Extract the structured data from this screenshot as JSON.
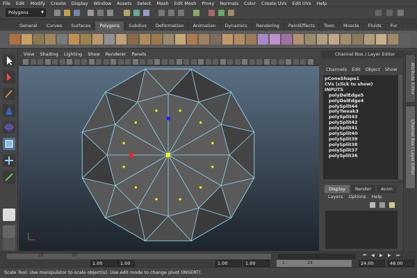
{
  "menubar": [
    "File",
    "Edit",
    "Modify",
    "Create",
    "Display",
    "Window",
    "Assets",
    "Select",
    "Mesh",
    "Edit Mesh",
    "Proxy",
    "Normals",
    "Color",
    "Create UVs",
    "Edit UVs",
    "Help"
  ],
  "status_line": {
    "mode": "Polygons"
  },
  "shelf_tabs": [
    "General",
    "Curves",
    "Surfaces",
    "Polygons",
    "Subdivs",
    "Deformation",
    "Animation",
    "Dynamics",
    "Rendering",
    "PaintEffects",
    "Toon",
    "Muscle",
    "Fluids",
    "Fur"
  ],
  "shelf_active": "Polygons",
  "panel_menu": [
    "View",
    "Shading",
    "Lighting",
    "Show",
    "Renderer",
    "Panels"
  ],
  "channel_box": {
    "title": "Channel Box / Layer Editor",
    "menu": [
      "Channels",
      "Edit",
      "Object",
      "Show"
    ],
    "items": [
      "pConeShape1",
      "CVs (click to show)",
      "INPUTS",
      "polyDelEdge5",
      "polyDelEdge4",
      "polySplit44",
      "polyTweak3",
      "polySplit43",
      "polySplit42",
      "polySplit41",
      "polySplit40",
      "polySplit39",
      "polySplit38",
      "polySplit37",
      "polySplit36"
    ]
  },
  "right_tabs": [
    "Attribute Editor",
    "Channel Box / Layer Editor"
  ],
  "layer_editor": {
    "tabs": [
      "Display",
      "Render",
      "Anim"
    ],
    "menu": [
      "Layers",
      "Options",
      "Help"
    ]
  },
  "time_slider": {
    "ticks": [
      "10",
      "20"
    ]
  },
  "range_slider": {
    "start_time": "1.00",
    "start_field": "1.00",
    "range_start": "1.00",
    "range_end": "1.00",
    "range_min": "1",
    "range_max": "24",
    "end_time": "24.00",
    "end_field": "48.00"
  },
  "help_line": "Scale Tool: Use manipulator to scale object(s). Use edit mode to change pivot (INSERT).",
  "colors": {
    "wire": "#8fd0e8",
    "accent_yellow": "#ffff00",
    "handle_red": "#ff2020",
    "handle_blue": "#2020ff"
  }
}
